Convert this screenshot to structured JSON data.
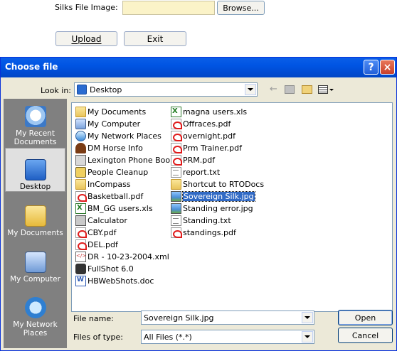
{
  "page": {
    "silks_label": "Silks File Image:",
    "browse_label": "Browse...",
    "upload_label": "Upload",
    "exit_label": "Exit",
    "upload_accel": "U",
    "exit_accel": "x"
  },
  "dialog": {
    "title": "Choose file",
    "help_button": "?",
    "close_button": "×",
    "look_in_label": "Look in:",
    "look_in_value": "Desktop",
    "places": [
      {
        "label": "My Recent Documents",
        "icon": "recent-documents-icon"
      },
      {
        "label": "Desktop",
        "icon": "desktop-icon",
        "selected": true
      },
      {
        "label": "My Documents",
        "icon": "my-documents-icon"
      },
      {
        "label": "My Computer",
        "icon": "my-computer-icon"
      },
      {
        "label": "My Network Places",
        "icon": "network-places-icon"
      }
    ],
    "files_col1": [
      {
        "name": "My Documents",
        "icon": "folder"
      },
      {
        "name": "My Computer",
        "icon": "computer"
      },
      {
        "name": "My Network Places",
        "icon": "net"
      },
      {
        "name": "DM Horse Info",
        "icon": "horse"
      },
      {
        "name": "Lexington Phone Book",
        "icon": "app"
      },
      {
        "name": "People Cleanup",
        "icon": "face"
      },
      {
        "name": "InCompass",
        "icon": "folder"
      },
      {
        "name": "Basketball.pdf",
        "icon": "pdf"
      },
      {
        "name": "BM_GG users.xls",
        "icon": "xls"
      },
      {
        "name": "Calculator",
        "icon": "calc"
      },
      {
        "name": "CBY.pdf",
        "icon": "pdf"
      },
      {
        "name": "DEL.pdf",
        "icon": "pdf"
      },
      {
        "name": "DR - 10-23-2004.xml",
        "icon": "xml"
      },
      {
        "name": "FullShot 6.0",
        "icon": "cam"
      },
      {
        "name": "HBWebShots.doc",
        "icon": "doc"
      }
    ],
    "files_col2": [
      {
        "name": "magna users.xls",
        "icon": "xls"
      },
      {
        "name": "Offraces.pdf",
        "icon": "pdf"
      },
      {
        "name": "overnight.pdf",
        "icon": "pdf"
      },
      {
        "name": "Prm Trainer.pdf",
        "icon": "pdf"
      },
      {
        "name": "PRM.pdf",
        "icon": "pdf"
      },
      {
        "name": "report.txt",
        "icon": "txt"
      },
      {
        "name": "Shortcut to RTODocs",
        "icon": "folder"
      },
      {
        "name": "Sovereign Silk.jpg",
        "icon": "jpg",
        "selected": true
      },
      {
        "name": "Standing error.jpg",
        "icon": "jpg"
      },
      {
        "name": "Standing.txt",
        "icon": "txt"
      },
      {
        "name": "standings.pdf",
        "icon": "pdf"
      }
    ],
    "file_name_label": "File name:",
    "file_name_value": "Sovereign Silk.jpg",
    "file_type_label": "Files of type:",
    "file_type_value": "All Files (*.*)",
    "open_label": "Open",
    "cancel_label": "Cancel",
    "toolbar_icons": [
      "back-arrow-icon",
      "up-folder-icon",
      "new-folder-icon",
      "views-menu-icon"
    ]
  }
}
